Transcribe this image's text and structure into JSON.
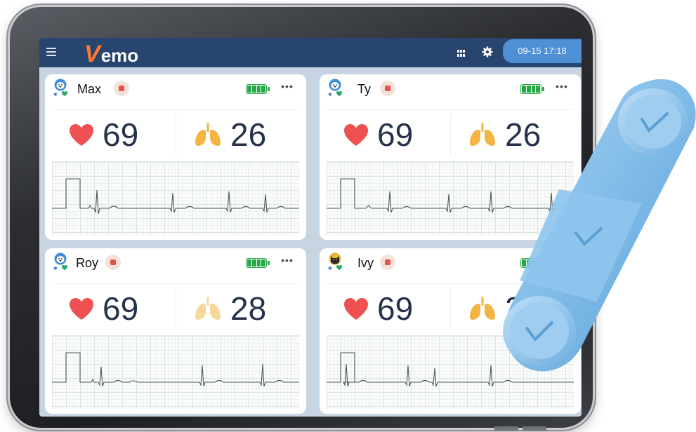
{
  "app": {
    "logo_initial": "V",
    "logo_rest": "emo",
    "datetime": "09-15 17:18"
  },
  "colors": {
    "header": "#27456f",
    "datetime_bg": "#4e8fd6",
    "accent": "#ff7a2f",
    "heart": "#ee5151",
    "lung": "#f2b443",
    "lung_faded": "#f7d89b",
    "battery": "#27a745"
  },
  "icons": {
    "menu": "menu-icon",
    "grid": "grid-icon",
    "settings": "gear-icon",
    "heart": "heart-icon",
    "lungs": "lungs-icon",
    "battery": "battery-icon",
    "more": "more-icon"
  },
  "patients": [
    {
      "name": "Max",
      "heart_rate": "69",
      "resp_rate": "26",
      "battery_level": 1.0
    },
    {
      "name": "Ty",
      "heart_rate": "69",
      "resp_rate": "26",
      "battery_level": 1.0
    },
    {
      "name": "Roy",
      "heart_rate": "69",
      "resp_rate": "28",
      "battery_level": 1.0
    },
    {
      "name": "Ivy",
      "heart_rate": "69",
      "resp_rate": "2",
      "battery_level": 1.0
    }
  ]
}
